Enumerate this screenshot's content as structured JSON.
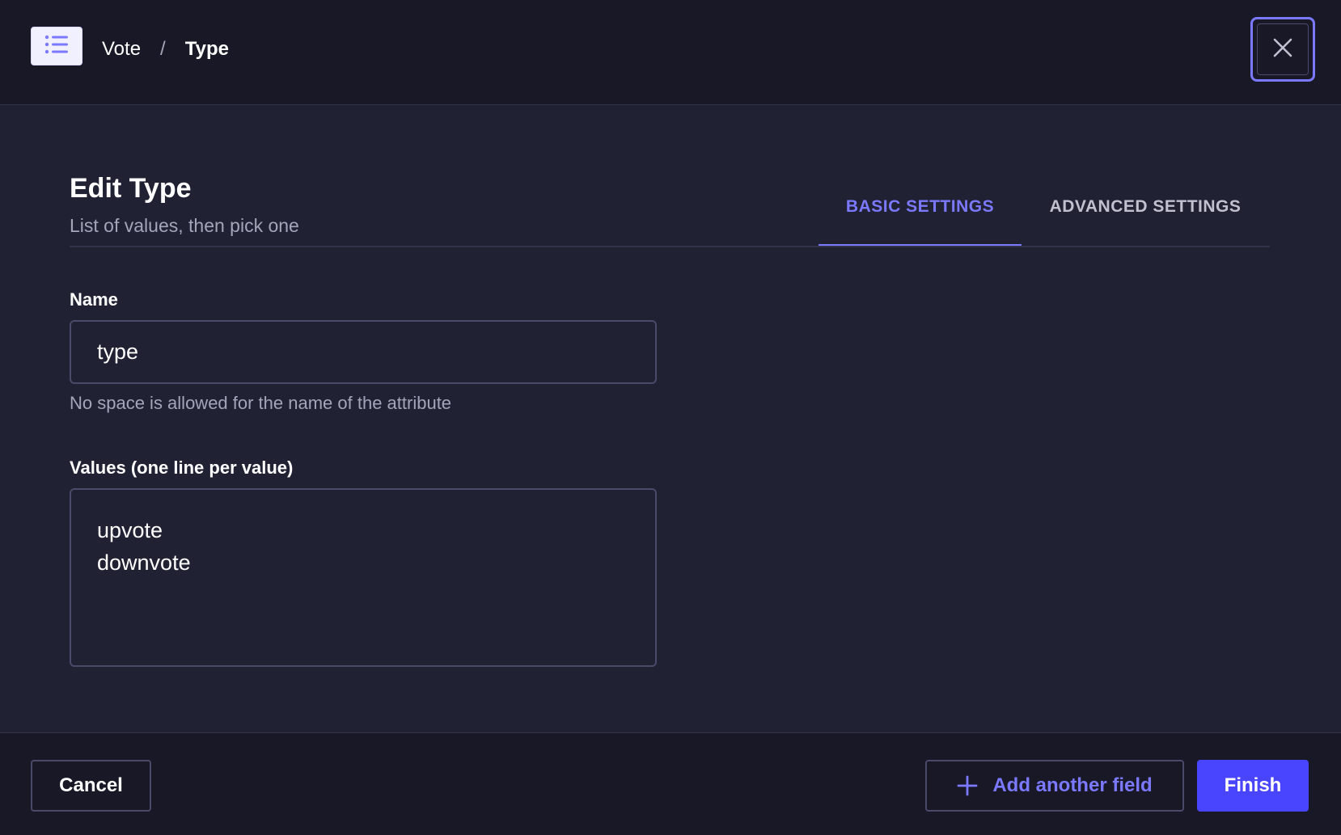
{
  "header": {
    "type_icon": "list-icon",
    "breadcrumb": {
      "parent": "Vote",
      "separator": "/",
      "current": "Type"
    },
    "close_icon": "close-icon"
  },
  "main": {
    "title": "Edit Type",
    "subtitle": "List of values, then pick one",
    "tabs": [
      {
        "label": "BASIC SETTINGS",
        "active": true
      },
      {
        "label": "ADVANCED SETTINGS",
        "active": false
      }
    ],
    "name_field": {
      "label": "Name",
      "value": "type",
      "hint": "No space is allowed for the name of the attribute"
    },
    "values_field": {
      "label": "Values (one line per value)",
      "value": "upvote\ndownvote"
    }
  },
  "footer": {
    "cancel_label": "Cancel",
    "add_label": "Add another field",
    "add_icon": "plus-icon",
    "finish_label": "Finish"
  },
  "colors": {
    "accent": "#7b79ff",
    "primary": "#4945ff",
    "background": "#212134",
    "header_bg": "#181826"
  }
}
